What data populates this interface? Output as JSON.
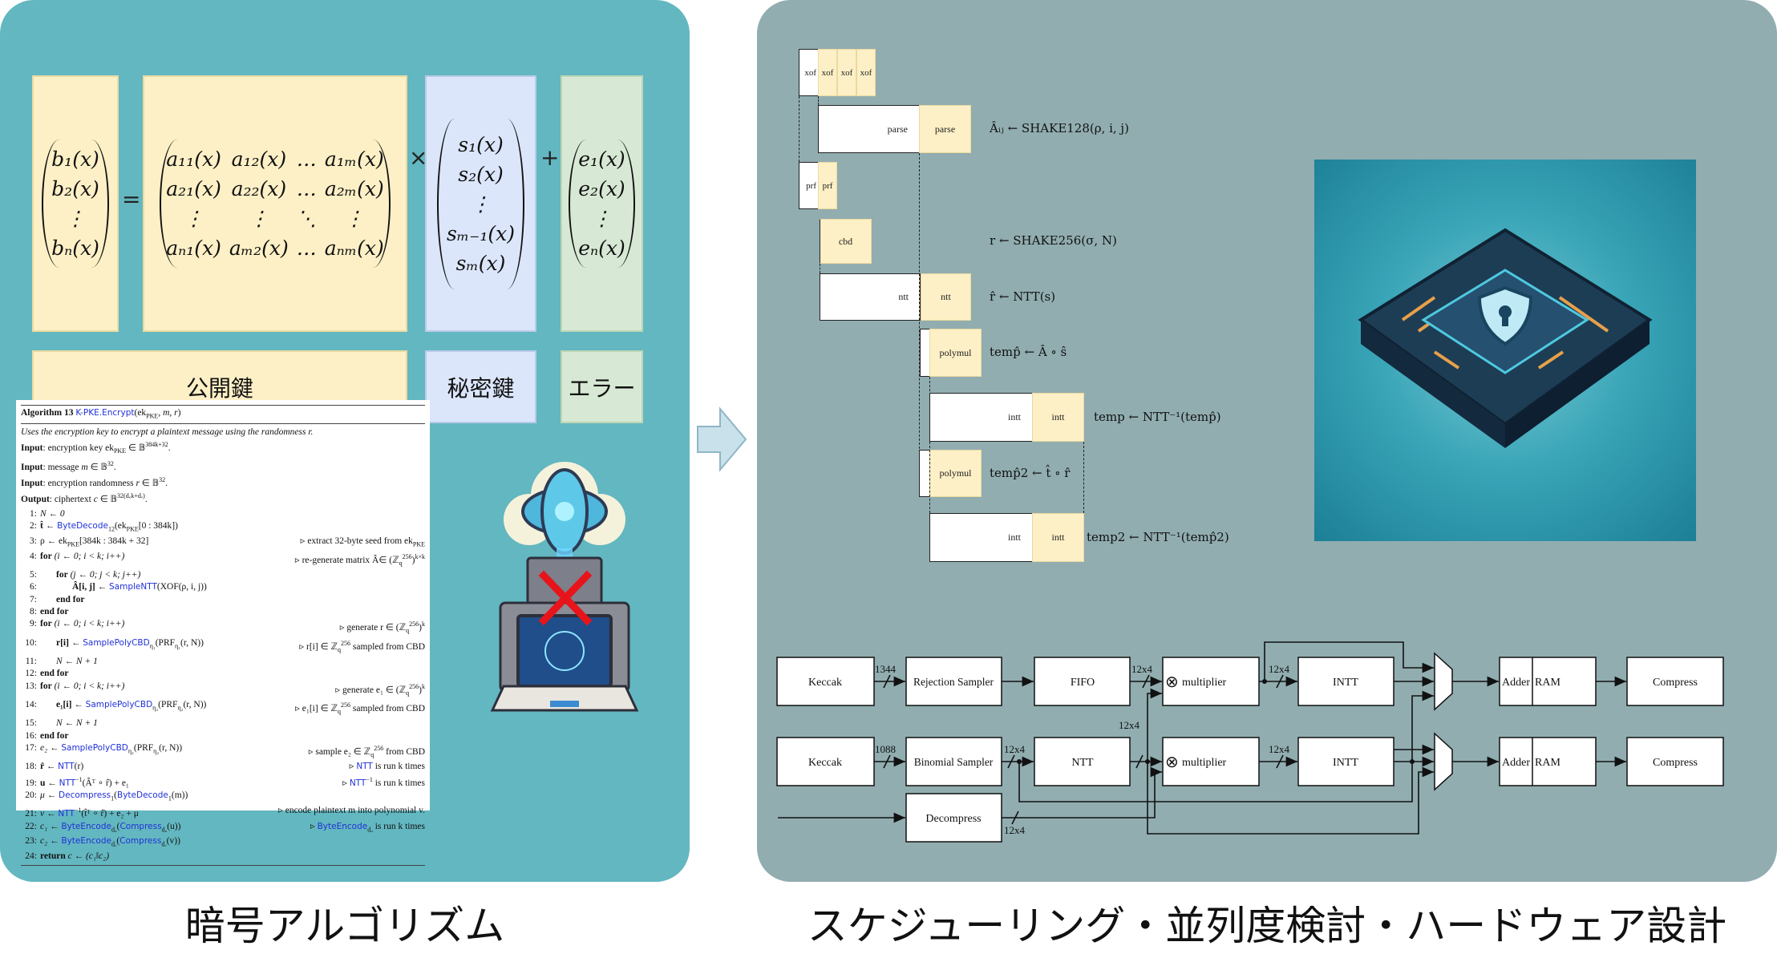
{
  "left_caption": "暗号アルゴリズム",
  "right_caption": "スケジューリング・並列度検討・ハードウェア設計",
  "equation": {
    "b": [
      "b₁(x)",
      "b₂(x)",
      "⋮",
      "bₙ(x)"
    ],
    "equals": "=",
    "A": [
      [
        "a₁₁(x)",
        "a₁₂(x)",
        "…",
        "a₁ₘ(x)"
      ],
      [
        "a₂₁(x)",
        "a₂₂(x)",
        "…",
        "a₂ₘ(x)"
      ],
      [
        "⋮",
        "⋮",
        "⋱",
        "⋮"
      ],
      [
        "aₙ₁(x)",
        "aₘ₂(x)",
        "…",
        "aₙₘ(x)"
      ]
    ],
    "times": "×",
    "s": [
      "s₁(x)",
      "s₂(x)",
      "⋮",
      "sₘ₋₁(x)",
      "sₘ(x)"
    ],
    "plus": "+",
    "e": [
      "e₁(x)",
      "e₂(x)",
      "⋮",
      "eₙ(x)"
    ],
    "labels": {
      "public_key": "公開鍵",
      "secret_key": "秘密鍵",
      "error": "エラー"
    }
  },
  "algorithm": {
    "title": [
      [
        "Algorithm 13 ",
        "b"
      ],
      [
        "K-PKE.Encrypt",
        "f"
      ],
      [
        "(ek",
        ""
      ],
      [
        "PKE",
        "sub"
      ],
      [
        ", ",
        ""
      ],
      [
        "m",
        "i"
      ],
      [
        ", ",
        ""
      ],
      [
        "r",
        "i"
      ],
      [
        ")",
        ""
      ]
    ],
    "description": "Uses the encryption key to encrypt a plaintext message using the randomness r.",
    "io": [
      [
        [
          "Input",
          "b"
        ],
        [
          ": encryption key ek",
          ""
        ],
        [
          "PKE",
          "sub"
        ],
        [
          " ∈ 𝔹",
          ""
        ],
        [
          "384k+32",
          "sup"
        ],
        [
          ".",
          ""
        ]
      ],
      [
        [
          "Input",
          "b"
        ],
        [
          ": message ",
          ""
        ],
        [
          "m",
          "i"
        ],
        [
          " ∈ 𝔹",
          ""
        ],
        [
          "32",
          "sup"
        ],
        [
          ".",
          ""
        ]
      ],
      [
        [
          "Input",
          "b"
        ],
        [
          ": encryption randomness ",
          ""
        ],
        [
          "r",
          "i"
        ],
        [
          " ∈ 𝔹",
          ""
        ],
        [
          "32",
          "sup"
        ],
        [
          ".",
          ""
        ]
      ],
      [
        [
          "Output",
          "b"
        ],
        [
          ": ciphertext ",
          ""
        ],
        [
          "c",
          "i"
        ],
        [
          " ∈ 𝔹",
          ""
        ],
        [
          "32(dᵤk+dᵥ)",
          "sup"
        ],
        [
          ".",
          ""
        ]
      ]
    ],
    "lines": [
      {
        "n": "1:",
        "indent": 0,
        "code": [
          [
            "N ← 0",
            "i"
          ]
        ],
        "comment": []
      },
      {
        "n": "2:",
        "indent": 0,
        "code": [
          [
            "t̂ ← ",
            "b"
          ],
          [
            "ByteDecode",
            "f"
          ],
          [
            "12",
            "sub"
          ],
          [
            "(ek",
            ""
          ],
          [
            "PKE",
            "sub"
          ],
          [
            "[0 : 384k])",
            ""
          ]
        ],
        "comment": []
      },
      {
        "n": "3:",
        "indent": 0,
        "code": [
          [
            "ρ ← ek",
            ""
          ],
          [
            "PKE",
            "sub"
          ],
          [
            "[384k : 384k + 32]",
            ""
          ]
        ],
        "comment": [
          [
            "▹ extract 32-byte seed from ek",
            ""
          ],
          [
            "PKE",
            "sub"
          ]
        ]
      },
      {
        "n": "4:",
        "indent": 0,
        "code": [
          [
            "for",
            "b"
          ],
          [
            " (i ← 0; i < k; i++)",
            "i"
          ]
        ],
        "comment": [
          [
            "▹ re-generate matrix Â∈ (ℤ",
            ""
          ],
          [
            "q",
            "sub"
          ],
          [
            "256",
            "sup"
          ],
          [
            ")",
            ""
          ],
          [
            "k×k",
            "sup"
          ]
        ]
      },
      {
        "n": "5:",
        "indent": 1,
        "code": [
          [
            "for",
            "b"
          ],
          [
            " (j ← 0; j < k; j++)",
            "i"
          ]
        ],
        "comment": []
      },
      {
        "n": "6:",
        "indent": 2,
        "code": [
          [
            "Â[i, j] ← ",
            "b"
          ],
          [
            "SampleNTT",
            "f"
          ],
          [
            "(XOF(ρ, i, j))",
            ""
          ]
        ],
        "comment": []
      },
      {
        "n": "7:",
        "indent": 1,
        "code": [
          [
            "end for",
            "b"
          ]
        ],
        "comment": []
      },
      {
        "n": "8:",
        "indent": 0,
        "code": [
          [
            "end for",
            "b"
          ]
        ],
        "comment": []
      },
      {
        "n": "9:",
        "indent": 0,
        "code": [
          [
            "for",
            "b"
          ],
          [
            " (i ← 0; i < k; i++)",
            "i"
          ]
        ],
        "comment": [
          [
            "▹ generate r ∈ (ℤ",
            ""
          ],
          [
            "q",
            "sub"
          ],
          [
            "256",
            "sup"
          ],
          [
            ")",
            ""
          ],
          [
            "k",
            "sup"
          ]
        ]
      },
      {
        "n": "10:",
        "indent": 1,
        "code": [
          [
            "r[i] ← ",
            "b"
          ],
          [
            "SamplePolyCBD",
            "f"
          ],
          [
            "η₁",
            "sub"
          ],
          [
            "(PRF",
            ""
          ],
          [
            "η₁",
            "sub"
          ],
          [
            "(r, N))",
            ""
          ]
        ],
        "comment": [
          [
            "▹ r[i] ∈ ℤ",
            ""
          ],
          [
            "q",
            "sub"
          ],
          [
            "256",
            "sup"
          ],
          [
            " sampled from CBD",
            ""
          ]
        ]
      },
      {
        "n": "11:",
        "indent": 1,
        "code": [
          [
            "N ← N + 1",
            "i"
          ]
        ],
        "comment": []
      },
      {
        "n": "12:",
        "indent": 0,
        "code": [
          [
            "end for",
            "b"
          ]
        ],
        "comment": []
      },
      {
        "n": "13:",
        "indent": 0,
        "code": [
          [
            "for",
            "b"
          ],
          [
            " (i ← 0; i < k; i++)",
            "i"
          ]
        ],
        "comment": [
          [
            "▹ generate e₁ ∈ (ℤ",
            ""
          ],
          [
            "q",
            "sub"
          ],
          [
            "256",
            "sup"
          ],
          [
            ")",
            ""
          ],
          [
            "k",
            "sup"
          ]
        ]
      },
      {
        "n": "14:",
        "indent": 1,
        "code": [
          [
            "e₁[i] ← ",
            "b"
          ],
          [
            "SamplePolyCBD",
            "f"
          ],
          [
            "η₂",
            "sub"
          ],
          [
            "(PRF",
            ""
          ],
          [
            "η₂",
            "sub"
          ],
          [
            "(r, N))",
            ""
          ]
        ],
        "comment": [
          [
            "▹ e₁[i] ∈ ℤ",
            ""
          ],
          [
            "q",
            "sub"
          ],
          [
            "256",
            "sup"
          ],
          [
            " sampled from CBD",
            ""
          ]
        ]
      },
      {
        "n": "15:",
        "indent": 1,
        "code": [
          [
            "N ← N + 1",
            "i"
          ]
        ],
        "comment": []
      },
      {
        "n": "16:",
        "indent": 0,
        "code": [
          [
            "end for",
            "b"
          ]
        ],
        "comment": []
      },
      {
        "n": "17:",
        "indent": 0,
        "code": [
          [
            "e₂ ← ",
            "i"
          ],
          [
            "SamplePolyCBD",
            "f"
          ],
          [
            "η₂",
            "sub"
          ],
          [
            "(PRF",
            ""
          ],
          [
            "η₂",
            "sub"
          ],
          [
            "(r, N))",
            ""
          ]
        ],
        "comment": [
          [
            "▹ sample e₂ ∈ ℤ",
            ""
          ],
          [
            "q",
            "sub"
          ],
          [
            "256",
            "sup"
          ],
          [
            " from CBD",
            ""
          ]
        ]
      },
      {
        "n": "18:",
        "indent": 0,
        "code": [
          [
            "r̂ ← ",
            "b"
          ],
          [
            "NTT",
            "f"
          ],
          [
            "(r)",
            ""
          ]
        ],
        "comment": [
          [
            "▹ ",
            ""
          ],
          [
            "NTT",
            "f"
          ],
          [
            " is run k times",
            ""
          ]
        ]
      },
      {
        "n": "19:",
        "indent": 0,
        "code": [
          [
            "u ← ",
            "b"
          ],
          [
            "NTT",
            "f"
          ],
          [
            "−1",
            "sup"
          ],
          [
            "(Âᵀ ∘ r̂) + e₁",
            ""
          ]
        ],
        "comment": [
          [
            "▹ ",
            ""
          ],
          [
            "NTT",
            "f"
          ],
          [
            "−1",
            "sup"
          ],
          [
            " is run k times",
            ""
          ]
        ]
      },
      {
        "n": "20:",
        "indent": 0,
        "code": [
          [
            "μ ← ",
            "i"
          ],
          [
            "Decompress",
            "f"
          ],
          [
            "1",
            "sub"
          ],
          [
            "(",
            ""
          ],
          [
            "ByteDecode",
            "f"
          ],
          [
            "1",
            "sub"
          ],
          [
            "(m))",
            ""
          ]
        ],
        "comment": []
      },
      {
        "n": "21:",
        "indent": 0,
        "code": [
          [
            "v ← ",
            "i"
          ],
          [
            "NTT",
            "f"
          ],
          [
            "−1",
            "sup"
          ],
          [
            "(t̂ᵀ ∘ r̂) + e₂ + μ",
            ""
          ]
        ],
        "comment": [
          [
            "▹ encode plaintext m into polynomial v.",
            ""
          ]
        ]
      },
      {
        "n": "22:",
        "indent": 0,
        "code": [
          [
            "c₁ ← ",
            "i"
          ],
          [
            "ByteEncode",
            "f"
          ],
          [
            "dᵤ",
            "sub"
          ],
          [
            "(",
            ""
          ],
          [
            "Compress",
            "f"
          ],
          [
            "dᵤ",
            "sub"
          ],
          [
            "(u))",
            ""
          ]
        ],
        "comment": [
          [
            "▹ ",
            ""
          ],
          [
            "ByteEncode",
            "f"
          ],
          [
            "dᵤ",
            "sub"
          ],
          [
            " is run k times",
            ""
          ]
        ]
      },
      {
        "n": "23:",
        "indent": 0,
        "code": [
          [
            "c₂ ← ",
            "i"
          ],
          [
            "ByteEncode",
            "f"
          ],
          [
            "dᵥ",
            "sub"
          ],
          [
            "(",
            ""
          ],
          [
            "Compress",
            "f"
          ],
          [
            "dᵥ",
            "sub"
          ],
          [
            "(v))",
            ""
          ]
        ],
        "comment": []
      },
      {
        "n": "24:",
        "indent": 0,
        "code": [
          [
            "return",
            "b"
          ],
          [
            " c ← (c₁‖c₂)",
            "i"
          ]
        ],
        "comment": []
      }
    ]
  },
  "schedule": {
    "xof": "xof",
    "parse": "parse",
    "prf": "prf",
    "cbd": "cbd",
    "ntt": "ntt",
    "polymul": "polymul",
    "intt": "intt",
    "formulas": {
      "parse": "Âᵢⱼ ← SHAKE128(ρ, i, j)",
      "cbd": "r ← SHAKE256(σ, N)",
      "ntt": "r̂ ← NTT(s)",
      "polymul1": "temp̂ ← Â ∘ ŝ",
      "intt1": "temp ← NTT⁻¹(temp̂)",
      "polymul2": "temp̂2 ← t̂ ∘ r̂",
      "intt2": "temp2 ← NTT⁻¹(temp̂2)"
    }
  },
  "hardware": {
    "keccak": "Keccak",
    "rejection_sampler": "Rejection Sampler",
    "fifo": "FIFO",
    "multiplier": "multiplier",
    "intt": "INTT",
    "adder": "Adder",
    "ram": "RAM",
    "compress": "Compress",
    "binomial_sampler": "Binomial Sampler",
    "ntt": "NTT",
    "decompress": "Decompress",
    "width_1344": "1344",
    "width_1088": "1088",
    "width_12x4": "12x4",
    "multiply_symbol": "⊗"
  },
  "colors": {
    "left_panel": "#63b7c0",
    "right_panel": "#91adb0",
    "public_key": "#fdf0c6",
    "secret_key": "#dbe6fb",
    "error": "#d7e9d4",
    "function_blue": "#2130d8",
    "cross_red": "#e8141b"
  }
}
